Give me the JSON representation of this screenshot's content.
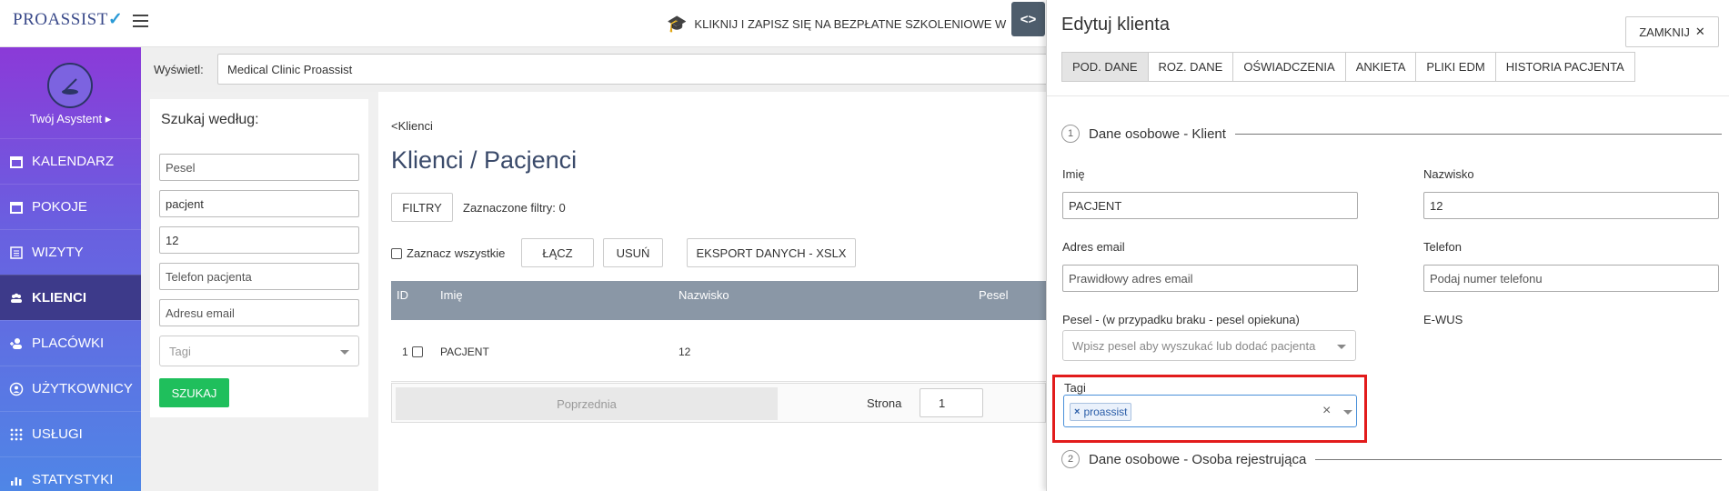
{
  "app": {
    "logo_text": "PROASSIST",
    "promo": "KLIKNIJ I ZAPISZ SIĘ NA BEZPŁATNE SZKOLENIOWE W"
  },
  "sidebar": {
    "assistant_label": "Twój Asystent ▸",
    "items": [
      {
        "label": "KALENDARZ",
        "icon": "calendar-icon"
      },
      {
        "label": "POKOJE",
        "icon": "calendar-icon"
      },
      {
        "label": "WIZYTY",
        "icon": "list-icon"
      },
      {
        "label": "KLIENCI",
        "icon": "users-icon",
        "active": true
      },
      {
        "label": "PLACÓWKI",
        "icon": "user-plus-icon"
      },
      {
        "label": "UŻYTKOWNICY",
        "icon": "user-circle-icon"
      },
      {
        "label": "USŁUGI",
        "icon": "grid-icon"
      },
      {
        "label": "STATYSTYKI",
        "icon": "bar-chart-icon"
      }
    ]
  },
  "display": {
    "label": "Wyświetl:",
    "value": "Medical Clinic Proassist"
  },
  "search": {
    "title": "Szukaj według:",
    "fields": [
      "Pesel",
      "pacjent",
      "12",
      "Telefon pacjenta",
      "Adresu email"
    ],
    "tags_placeholder": "Tagi",
    "button": "SZUKAJ"
  },
  "main": {
    "back_link": "<Klienci",
    "title": "Klienci / Pacjenci",
    "filters_button": "FILTRY",
    "filters_info": "Zaznaczone filtry: 0",
    "select_all": "Zaznacz wszystkie",
    "merge_button": "ŁĄCZ",
    "delete_button": "USUŃ",
    "export_button": "EKSPORT DANYCH - XSLX",
    "table": {
      "columns": [
        "ID",
        "Imię",
        "Nazwisko",
        "Pesel"
      ],
      "rows": [
        {
          "id": "1",
          "first_name": "PACJENT",
          "last_name": "12",
          "pesel": ""
        }
      ]
    },
    "pager": {
      "prev": "Poprzednia",
      "page_label": "Strona",
      "page": "1"
    }
  },
  "edit": {
    "title": "Edytuj klienta",
    "close_button": "ZAMKNIJ",
    "tabs": [
      "POD. DANE",
      "ROZ. DANE",
      "OŚWIADCZENIA",
      "ANKIETA",
      "PLIKI EDM",
      "HISTORIA PACJENTA"
    ],
    "section1": {
      "num": "1",
      "title": "Dane osobowe - Klient"
    },
    "section2": {
      "num": "2",
      "title": "Dane osobowe - Osoba rejestrująca"
    },
    "fields": {
      "first_name_label": "Imię",
      "first_name": "PACJENT",
      "last_name_label": "Nazwisko",
      "last_name": "12",
      "email_label": "Adres email",
      "email_placeholder": "Prawidłowy adres email",
      "phone_label": "Telefon",
      "phone_placeholder": "Podaj numer telefonu",
      "pesel_label": "Pesel - (w przypadku braku - pesel opiekuna)",
      "pesel_placeholder": "Wpisz pesel aby wyszukać lub dodać pacjenta",
      "ewus_label": "E-WUS",
      "tags_label": "Tagi",
      "tag_chip": "proassist"
    }
  },
  "colors": {
    "accent_green": "#1fbf5c",
    "highlight_red": "#e21b1b",
    "sidebar_active": "#3d3a8a"
  }
}
